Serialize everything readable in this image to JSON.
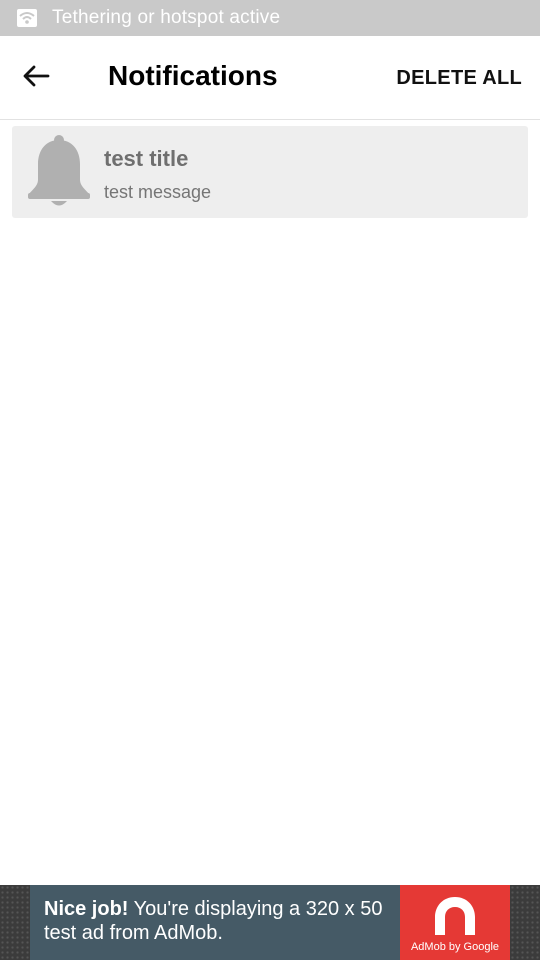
{
  "status_bar": {
    "text": "Tethering or hotspot active",
    "icon": "hotspot-icon"
  },
  "app_bar": {
    "title": "Notifications",
    "back_icon": "arrow-left-icon",
    "action_label": "DELETE ALL"
  },
  "notifications": [
    {
      "icon": "bell-icon",
      "title": "test title",
      "message": "test message"
    }
  ],
  "ad": {
    "headline": "Nice job!",
    "body": " You're displaying a 320 x 50 test ad from AdMob.",
    "logo_label": "AdMob by Google",
    "colors": {
      "banner": "#455a66",
      "logo_bg": "#e53935"
    }
  }
}
